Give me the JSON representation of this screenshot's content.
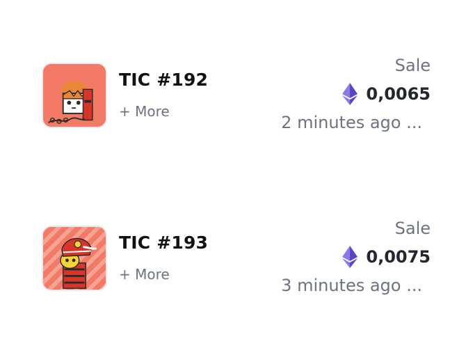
{
  "activity": [
    {
      "title": "TIC #192",
      "more_label": "+ More",
      "event": "Sale",
      "currency_icon": "ethereum-icon",
      "price": "0,0065",
      "time": "2 minutes ago ..."
    },
    {
      "title": "TIC #193",
      "more_label": "+ More",
      "event": "Sale",
      "currency_icon": "ethereum-icon",
      "price": "0,0075",
      "time": "3 minutes ago ..."
    }
  ],
  "colors": {
    "thumb_bg": "#f27a66",
    "title": "#111111",
    "muted": "#6b7480",
    "eth": "#6f5bd6"
  }
}
